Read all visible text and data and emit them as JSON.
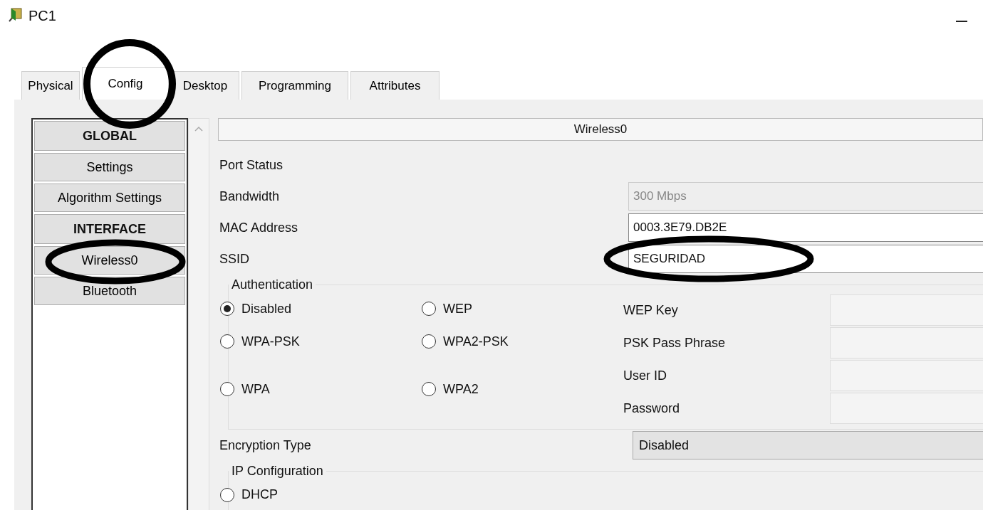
{
  "window": {
    "title": "PC1"
  },
  "tabs": [
    {
      "label": "Physical",
      "selected": false
    },
    {
      "label": "Config",
      "selected": true
    },
    {
      "label": "Desktop",
      "selected": false
    },
    {
      "label": "Programming",
      "selected": false
    },
    {
      "label": "Attributes",
      "selected": false
    }
  ],
  "sidebar": {
    "items": [
      {
        "label": "GLOBAL",
        "kind": "header"
      },
      {
        "label": "Settings",
        "kind": "item"
      },
      {
        "label": "Algorithm Settings",
        "kind": "item"
      },
      {
        "label": "INTERFACE",
        "kind": "header"
      },
      {
        "label": "Wireless0",
        "kind": "item"
      },
      {
        "label": "Bluetooth",
        "kind": "item"
      }
    ]
  },
  "panel": {
    "title": "Wireless0",
    "port_status": "Port Status",
    "fields": [
      {
        "label": "Bandwidth",
        "value": "300 Mbps",
        "disabled": true
      },
      {
        "label": "MAC Address",
        "value": "0003.3E79.DB2E",
        "disabled": false
      },
      {
        "label": "SSID",
        "value": "SEGURIDAD",
        "disabled": false
      }
    ],
    "authentication": {
      "title": "Authentication",
      "options": [
        {
          "label": "Disabled",
          "selected": true
        },
        {
          "label": "WEP",
          "selected": false
        },
        {
          "label": "WPA-PSK",
          "selected": false
        },
        {
          "label": "WPA2-PSK",
          "selected": false
        },
        {
          "label": "WPA",
          "selected": false
        },
        {
          "label": "WPA2",
          "selected": false
        }
      ],
      "fields": [
        {
          "label": "WEP Key"
        },
        {
          "label": "PSK Pass Phrase"
        },
        {
          "label": "User ID"
        },
        {
          "label": "Password"
        }
      ]
    },
    "encryption": {
      "label": "Encryption Type",
      "value": "Disabled"
    },
    "ip_configuration": {
      "title": "IP Configuration",
      "options": [
        {
          "label": "DHCP",
          "selected": false
        }
      ]
    }
  }
}
